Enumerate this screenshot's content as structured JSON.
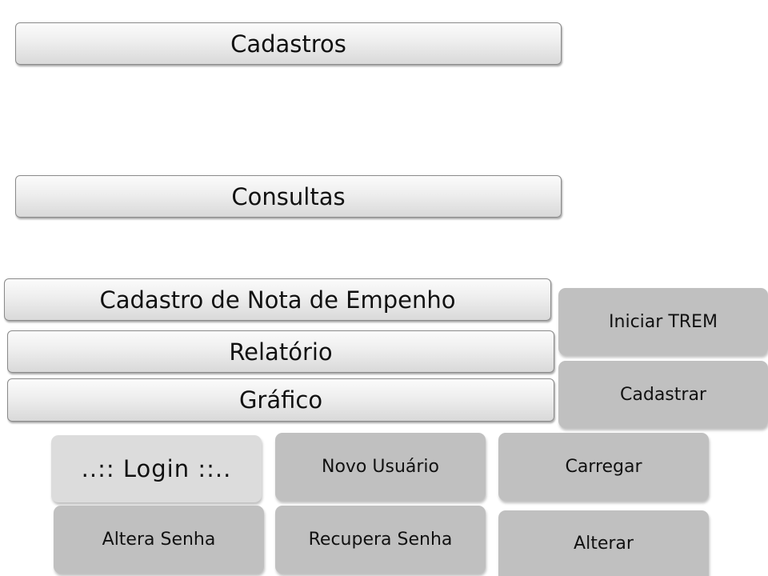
{
  "menu": {
    "cadastros": "Cadastros",
    "consultas": "Consultas",
    "cadastro_nota_empenho": "Cadastro de Nota de Empenho",
    "relatorio": "Relatório",
    "grafico": "Gráfico"
  },
  "actions": {
    "iniciar_trem": "Iniciar TREM",
    "cadastrar": "Cadastrar",
    "login": "..:: Login ::..",
    "novo_usuario": "Novo Usuário",
    "carregar": "Carregar",
    "altera_senha": "Altera Senha",
    "recupera_senha": "Recupera Senha",
    "alterar": "Alterar"
  },
  "colors": {
    "tile_background": "#c0c0c0",
    "login_tile_background": "#dcdcdc"
  }
}
